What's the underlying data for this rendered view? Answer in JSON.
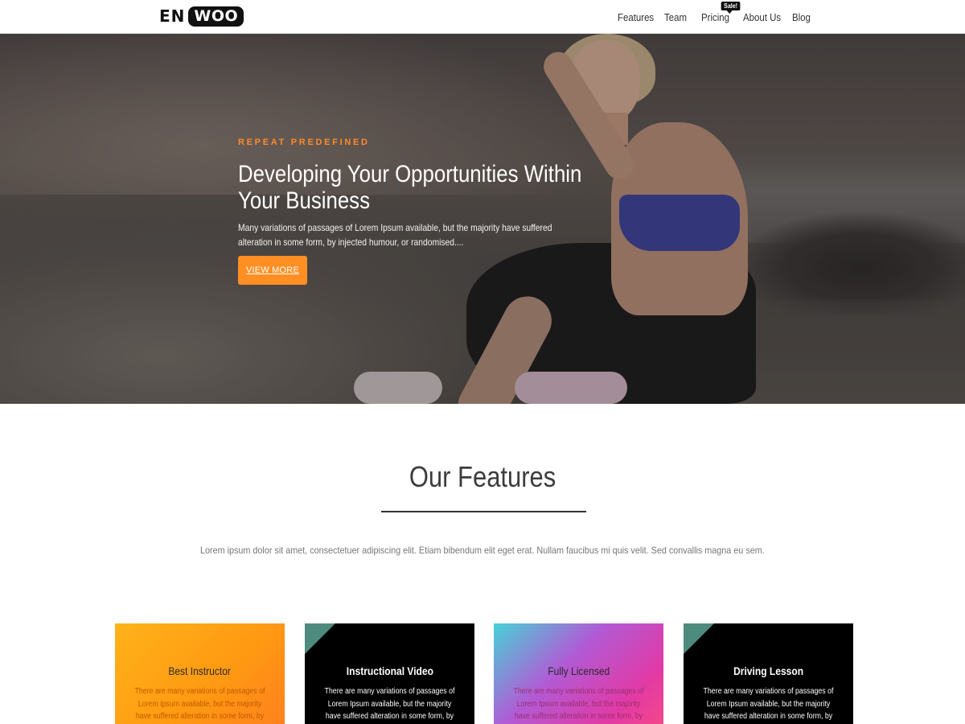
{
  "header": {
    "logo_en": "EN",
    "logo_woo": "WOO",
    "nav": [
      {
        "label": "Features"
      },
      {
        "label": "Team"
      },
      {
        "label": "Pricing",
        "badge": "Sale!"
      },
      {
        "label": "About Us"
      },
      {
        "label": "Blog"
      }
    ]
  },
  "hero": {
    "eyebrow": "REPEAT PREDEFINED",
    "title": "Developing Your Opportunities Within Your Business",
    "text": "Many variations of passages of Lorem Ipsum available, but the majority have suffered alteration in some form, by injected humour, or randomised....",
    "button_label": "VIEW MORE",
    "accent": "#ff8f23"
  },
  "features": {
    "title": "Our Features",
    "description": "Lorem ipsum dolor sit amet, consectetuer adipiscing elit. Etiam bibendum elit eget erat. Nullam faucibus mi quis velit. Sed convallis magna eu sem.",
    "cards": [
      {
        "title": "Best Instructor",
        "text": "There are many variations of passages of Lorem Ipsum available, but the majority have suffered alteration in some form, by injected"
      },
      {
        "title": "Instructional Video",
        "text": "There are many variations of passages of Lorem Ipsum available, but the majority have suffered alteration in some form, by injected"
      },
      {
        "title": "Fully Licensed",
        "text": "There are many variations of passages of Lorem Ipsum available, but the majority have suffered alteration in some form, by injected"
      },
      {
        "title": "Driving Lesson",
        "text": "There are many variations of passages of Lorem Ipsum available, but the majority have suffered alteration in some form, by injected"
      }
    ]
  }
}
